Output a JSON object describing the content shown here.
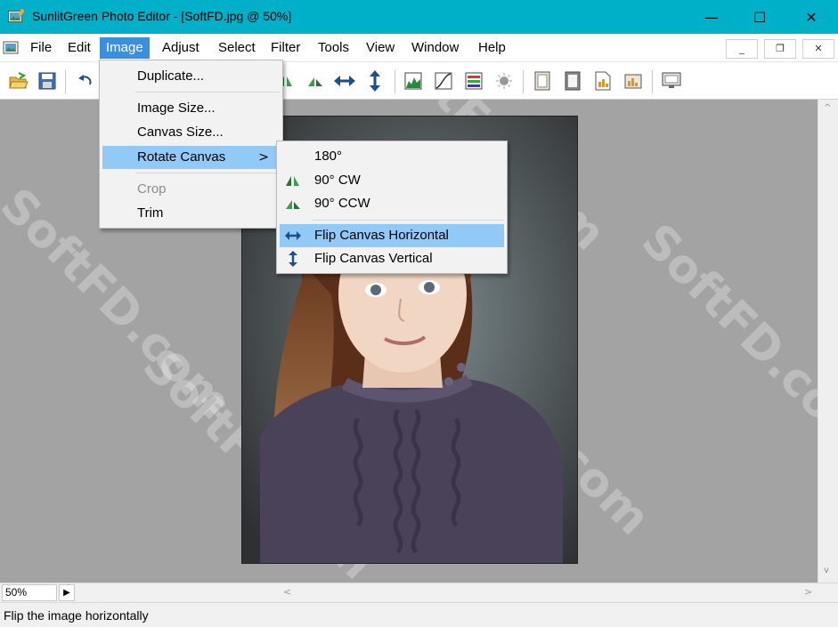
{
  "window": {
    "title": "SunlitGreen Photo Editor - [SoftFD.jpg @ 50%]",
    "minimize_glyph": "—",
    "maximize_glyph": "☐",
    "close_glyph": "✕"
  },
  "menubar": {
    "items": [
      "File",
      "Edit",
      "Image",
      "Adjust",
      "Select",
      "Filter",
      "Tools",
      "View",
      "Window",
      "Help"
    ],
    "active": "Image",
    "mdi_minimize": "_",
    "mdi_restore": "❐",
    "mdi_close": "✕"
  },
  "toolbar": {
    "icons": [
      "open-icon",
      "save-icon",
      "undo-icon",
      "rotate-cw-icon",
      "rotate-ccw-icon",
      "flip-horizontal-icon",
      "flip-vertical-icon",
      "levels-icon",
      "curves-icon",
      "color-balance-icon",
      "brightness-icon",
      "frame-icon",
      "border-icon",
      "document-icon",
      "canvas-icon",
      "monitor-icon"
    ]
  },
  "image_menu": {
    "items": [
      {
        "label": "Duplicate...",
        "enabled": true
      },
      {
        "label": "Image Size...",
        "enabled": true
      },
      {
        "label": "Canvas Size...",
        "enabled": true
      },
      {
        "label": "Rotate Canvas",
        "enabled": true,
        "has_submenu": true,
        "submenu_arrow": ">"
      },
      {
        "label": "Crop",
        "enabled": false
      },
      {
        "label": "Trim",
        "enabled": true
      }
    ]
  },
  "rotate_submenu": {
    "items": [
      {
        "label": "180°",
        "icon": "none"
      },
      {
        "label": "90° CW",
        "icon": "rotate-cw-icon"
      },
      {
        "label": "90° CCW",
        "icon": "rotate-ccw-icon"
      },
      {
        "label": "Flip Canvas Horizontal",
        "icon": "flip-horizontal-icon",
        "highlighted": true
      },
      {
        "label": "Flip Canvas Vertical",
        "icon": "flip-vertical-icon"
      }
    ]
  },
  "navigation": {
    "zoom": "50%",
    "zoom_arrow": "▶",
    "scroll_left": "<",
    "scroll_right": ">",
    "scroll_up": "^",
    "scroll_down": "v"
  },
  "status": {
    "text": "Flip the image horizontally"
  },
  "watermark": "SoftFD.com",
  "colors": {
    "titlebar": "#00b0c8",
    "menu_active": "#3b8fe0",
    "menu_highlight": "#91c9f7",
    "workspace": "#a3a3a3"
  }
}
